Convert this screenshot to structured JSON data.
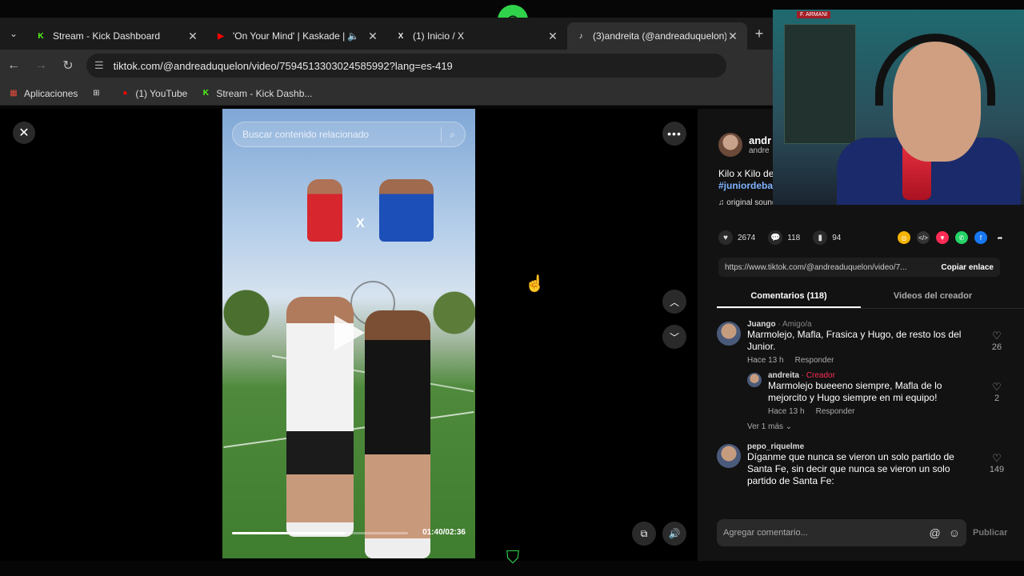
{
  "browser": {
    "tabs": [
      {
        "label": "Stream - Kick Dashboard",
        "favicon": "K",
        "favicon_color": "#53fc18",
        "active": false
      },
      {
        "label": "'On Your Mind' | Kaskade | C",
        "favicon": "▶",
        "favicon_color": "#ff0000",
        "active": false
      },
      {
        "label": "(1) Inicio / X",
        "favicon": "X",
        "favicon_color": "#ffffff",
        "active": false
      },
      {
        "label": "(3)andreita (@andreaduquelon)",
        "favicon": "♪",
        "favicon_color": "#ffffff",
        "active": true
      }
    ],
    "url": "tiktok.com/@andreaduquelon/video/7594513303024585992?lang=es-419",
    "bookmarks": [
      {
        "label": "Aplicaciones"
      },
      {
        "label": "(1) YouTube"
      },
      {
        "label": "Stream - Kick Dashb..."
      }
    ]
  },
  "video": {
    "search_placeholder": "Buscar contenido relacionado",
    "vs_label": "X",
    "time": "01:40/02:36",
    "progress_fraction": 0.641
  },
  "panel": {
    "author_name": "andr",
    "author_handle": "andre",
    "description": "Kilo x Kilo de",
    "hashtag": "#juniordeba",
    "sound": "original sound - andreita",
    "likes": "2674",
    "comments_count": "118",
    "saves": "94",
    "link": "https://www.tiktok.com/@andreaduquelon/video/7...",
    "copy_label": "Copiar enlace",
    "tab_comments": "Comentarios (118)",
    "tab_creator": "Videos del creador",
    "comments": [
      {
        "user": "Juango",
        "role": " · Amigo/a",
        "text": "Marmolejo, Mafla, Frasica y Hugo, de resto los del Junior.",
        "time": "Hace 13 h",
        "reply_label": "Responder",
        "likes": "26"
      },
      {
        "user": "andreita",
        "role": " · Creador",
        "text": "Marmolejo bueeeno siempre, Mafla de lo mejorcito y Hugo siempre en mi equipo!",
        "time": "Hace 13 h",
        "reply_label": "Responder",
        "likes": "2"
      },
      {
        "user": "pepo_riquelme",
        "role": "",
        "text": "Díganme que nunca se vieron un solo partido de Santa Fe, sin decir que nunca se vieron un solo partido de Santa Fe:",
        "time": "",
        "reply_label": "",
        "likes": "149"
      }
    ],
    "more_replies": "Ver 1 más ⌄",
    "composer_placeholder": "Agregar comentario...",
    "post_label": "Publicar"
  },
  "overlay": {
    "cam_label_left": "F. ARMANI",
    "cam_label_right": ""
  }
}
